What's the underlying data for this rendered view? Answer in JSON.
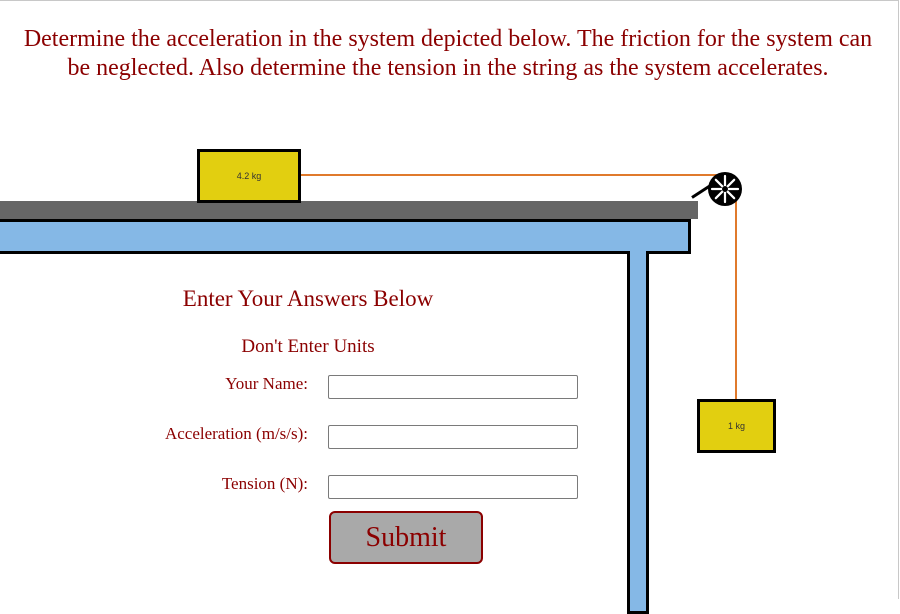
{
  "problem": {
    "text": "Determine the acceleration in the system depicted below. The friction for the system can be neglected. Also determine the tension in the string as the system accelerates."
  },
  "diagram": {
    "table_block_label": "4.2 kg",
    "hanging_block_label": "1 kg",
    "colors": {
      "block": "#e2cf10",
      "table": "#85b8e6",
      "surface": "#666666",
      "string": "#e07a2c"
    }
  },
  "form": {
    "heading": "Enter Your Answers Below",
    "subheading": "Don't Enter Units",
    "name_label": "Your Name:",
    "name_value": "",
    "acceleration_label": "Acceleration (m/s/s):",
    "acceleration_value": "",
    "tension_label": "Tension (N):",
    "tension_value": "",
    "submit_label": "Submit",
    "accent_color": "#8b0000"
  }
}
